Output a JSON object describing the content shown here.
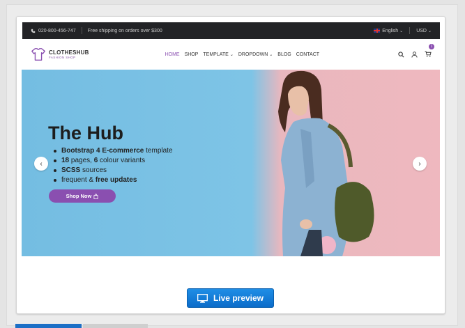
{
  "topbar": {
    "phone": "020-800-456-747",
    "shipping": "Free shipping on orders over $300",
    "language": "English",
    "currency": "USD"
  },
  "nav": {
    "logo_name": "CLOTHESHUB",
    "logo_sub": "FASHION SHOP",
    "menu": [
      "HOME",
      "SHOP",
      "TEMPLATE",
      "DROPDOWN",
      "BLOG",
      "CONTACT"
    ],
    "cart_count": "1"
  },
  "hero": {
    "title": "The Hub",
    "list": [
      {
        "bold": "Bootstrap 4 E-commerce",
        "rest": " template"
      },
      {
        "bold": "18",
        "rest": " pages, ",
        "bold2": "6",
        "rest2": " colour variants"
      },
      {
        "bold": "SCSS",
        "rest": " sources"
      },
      {
        "pre": "frequent & ",
        "bold": "free updates"
      }
    ],
    "button": "Shop Now"
  },
  "live_preview": "Live preview",
  "colors": {
    "accent": "#8a4fb0",
    "topbar": "#222326",
    "hero_blue": "#7ec4e6",
    "hero_pink": "#efb8bf",
    "button_blue": "#0b6cc9"
  }
}
